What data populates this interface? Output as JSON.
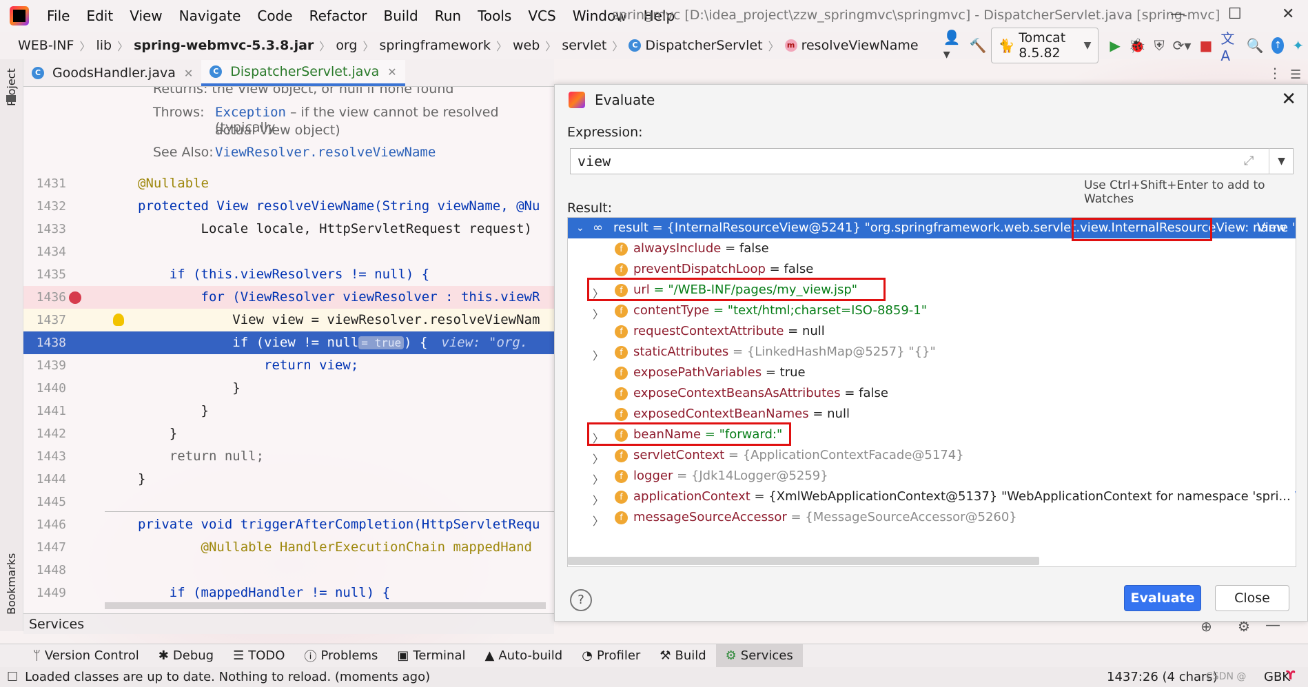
{
  "app": {
    "menu": [
      "File",
      "Edit",
      "View",
      "Navigate",
      "Code",
      "Refactor",
      "Build",
      "Run",
      "Tools",
      "VCS",
      "Window",
      "Help"
    ],
    "window_title": "springmvc [D:\\idea_project\\zzw_springmvc\\springmvc] - DispatcherServlet.java [spring-mvc]"
  },
  "nav": {
    "crumbs": [
      "WEB-INF",
      "lib",
      "spring-webmvc-5.3.8.jar",
      "org",
      "springframework",
      "web",
      "servlet",
      "DispatcherServlet",
      "resolveViewName"
    ],
    "run_config": "Tomcat 8.5.82"
  },
  "tabs": [
    {
      "label": "GoodsHandler.java"
    },
    {
      "label": "DispatcherServlet.java"
    }
  ],
  "sidebar": {
    "project": "Project",
    "bookmarks": "Bookmarks"
  },
  "doc": {
    "returns": "Returns:  the View object, or null if none found",
    "throws_label": "Throws:",
    "throws_link": "Exception",
    "throws_text": " – if the view cannot be resolved (typically",
    "throws_text2": "actual View object)",
    "seealso_label": "See Also:",
    "seealso_link": "ViewResolver.resolveViewName"
  },
  "code_lines": [
    {
      "n": "1431",
      "t": "@Nullable"
    },
    {
      "n": "1432",
      "t": "protected View resolveViewName(String viewName, @Nu"
    },
    {
      "n": "1433",
      "t": "        Locale locale, HttpServletRequest request)"
    },
    {
      "n": "1434",
      "t": ""
    },
    {
      "n": "1435",
      "t": "    if (this.viewResolvers != null) {"
    },
    {
      "n": "1436",
      "t": "        for (ViewResolver viewResolver : this.viewR"
    },
    {
      "n": "1437",
      "t": "            View view = viewResolver.resolveViewNam"
    },
    {
      "n": "1438",
      "t": "            if (view != null"
    },
    {
      "n": "1439",
      "t": "                return view;"
    },
    {
      "n": "1440",
      "t": "            }"
    },
    {
      "n": "1441",
      "t": "        }"
    },
    {
      "n": "1442",
      "t": "    }"
    },
    {
      "n": "1443",
      "t": "    return null;"
    },
    {
      "n": "1444",
      "t": "}"
    },
    {
      "n": "1445",
      "t": ""
    },
    {
      "n": "1446",
      "t": "private void triggerAfterCompletion(HttpServletRequ"
    },
    {
      "n": "1447",
      "t": "        @Nullable HandlerExecutionChain mappedHand"
    },
    {
      "n": "1448",
      "t": ""
    },
    {
      "n": "1449",
      "t": "    if (mappedHandler != null) {"
    }
  ],
  "inline_hint": "= true",
  "inline_tail": ") {",
  "inline_val": "view: \"org.",
  "services_label": "Services",
  "evaluate": {
    "title": "Evaluate",
    "expression_label": "Expression:",
    "expression": "view",
    "hint": "Use Ctrl+Shift+Enter to add to Watches",
    "result_label": "Result:",
    "result_line": "result = {InternalResourceView@5241} \"org.springframework.web.servlet.view.InternalResourceView: name '...",
    "view_link": "View",
    "fields": [
      {
        "name": "alwaysInclude",
        "value": "= false"
      },
      {
        "name": "preventDispatchLoop",
        "value": "= false"
      },
      {
        "name": "url",
        "value": "= \"/WEB-INF/pages/my_view.jsp\""
      },
      {
        "name": "contentType",
        "value": "= \"text/html;charset=ISO-8859-1\""
      },
      {
        "name": "requestContextAttribute",
        "value": "= null"
      },
      {
        "name": "staticAttributes",
        "value": "= {LinkedHashMap@5257} \"{}\""
      },
      {
        "name": "exposePathVariables",
        "value": "= true"
      },
      {
        "name": "exposeContextBeansAsAttributes",
        "value": "= false"
      },
      {
        "name": "exposedContextBeanNames",
        "value": "= null"
      },
      {
        "name": "beanName",
        "value": "= \"forward:\""
      },
      {
        "name": "servletContext",
        "value": "= {ApplicationContextFacade@5174}"
      },
      {
        "name": "logger",
        "value": "= {Jdk14Logger@5259}"
      },
      {
        "name": "applicationContext",
        "value": "= {XmlWebApplicationContext@5137} \"WebApplicationContext for namespace 'spri..."
      },
      {
        "name": "messageSourceAccessor",
        "value": "= {MessageSourceAccessor@5260}"
      }
    ],
    "evaluate_button": "Evaluate",
    "close_button": "Close"
  },
  "bottom_tools": [
    "Version Control",
    "Debug",
    "TODO",
    "Problems",
    "Terminal",
    "Auto-build",
    "Profiler",
    "Build",
    "Services"
  ],
  "status": {
    "message": "Loaded classes are up to date. Nothing to reload. (moments ago)",
    "position": "1437:26 (4 chars)",
    "encoding": "GBK",
    "watermark": "CSDN @"
  }
}
